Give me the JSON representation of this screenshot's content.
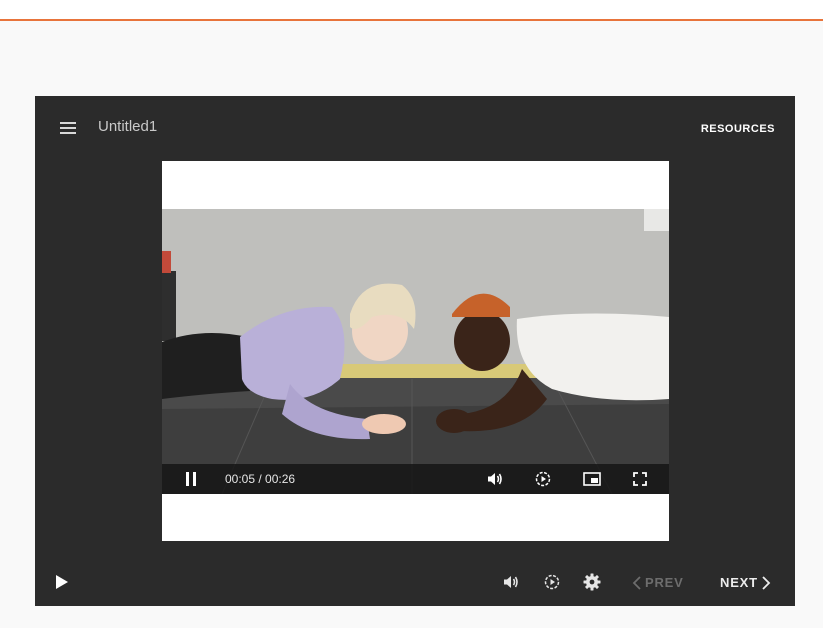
{
  "header": {
    "title": "Untitled1",
    "resources_label": "RESOURCES"
  },
  "video": {
    "current_time": "00:05",
    "duration": "00:26",
    "time_separator": " / "
  },
  "footer": {
    "prev_label": "PREV",
    "next_label": "NEXT"
  },
  "icons": {
    "menu": "menu-icon",
    "pause": "pause-icon",
    "volume": "volume-icon",
    "playback_speed": "playback-speed-icon",
    "picture_in_picture": "picture-in-picture-icon",
    "fullscreen": "fullscreen-icon",
    "play": "play-icon",
    "settings": "gear-icon",
    "prev": "chevron-left-icon",
    "next": "chevron-right-icon"
  },
  "colors": {
    "accent": "#e8743b",
    "player_background": "#2b2b2b",
    "disabled_text": "#6d6d6d"
  }
}
